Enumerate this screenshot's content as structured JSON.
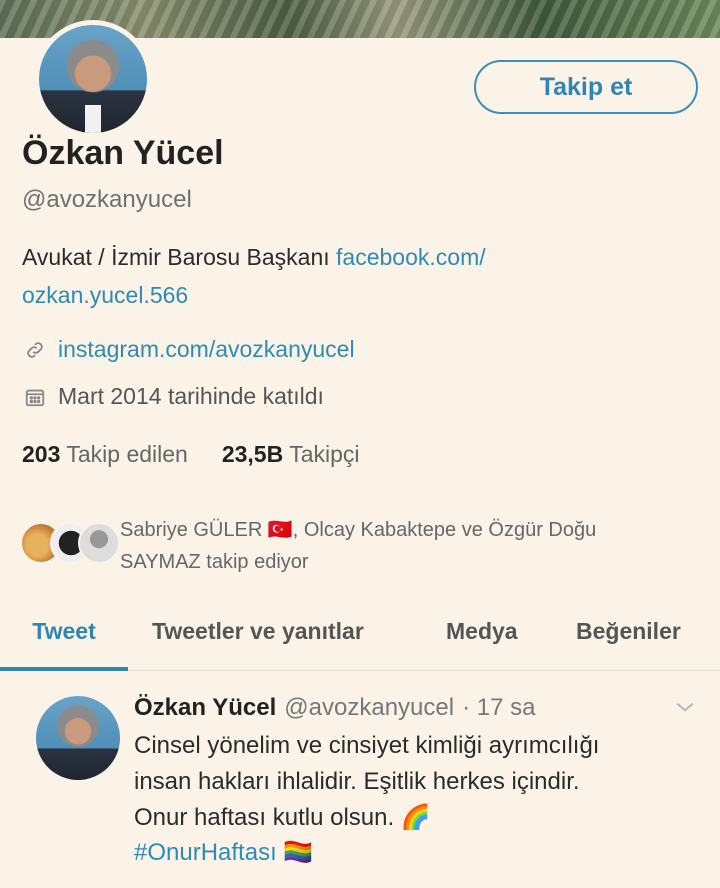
{
  "profile": {
    "name": "Özkan Yücel",
    "handle": "@avozkanyucel",
    "bio_text": "Avukat / İzmir Barosu Başkanı ",
    "bio_link_1": "facebook.com/",
    "bio_link_2": "ozkan.yucel.566",
    "website": "instagram.com/avozkanyucel",
    "joined": "Mart 2014 tarihinde katıldı",
    "following_count": "203",
    "following_label": "Takip edilen",
    "followers_count": "23,5B",
    "followers_label": "Takipçi"
  },
  "follow_button": {
    "label": "Takip et"
  },
  "followed_by": {
    "line1": "Sabriye GÜLER 🇹🇷, Olcay Kabaktepe ve Özgür Doğu",
    "line2": "SAYMAZ takip ediyor"
  },
  "tabs": [
    {
      "label": "Tweet",
      "active": true
    },
    {
      "label": "Tweetler ve yanıtlar",
      "active": false
    },
    {
      "label": "Medya",
      "active": false
    },
    {
      "label": "Beğeniler",
      "active": false
    }
  ],
  "tweet": {
    "author": "Özkan Yücel",
    "handle": "@avozkanyucel",
    "time": "· 17 sa",
    "line1": "Cinsel yönelim ve cinsiyet kimliği ayrımcılığı",
    "line2": "insan hakları ihlalidir. Eşitlik herkes içindir.",
    "line3": "Onur haftası kutlu olsun. 🌈",
    "hashtag": "#OnurHaftası 🏳️‍🌈"
  },
  "colors": {
    "accent": "#2f86b3",
    "background": "#fbf3e8"
  },
  "icons": {
    "link": "link-icon",
    "calendar": "calendar-icon",
    "menu": "chevron-down-icon"
  }
}
